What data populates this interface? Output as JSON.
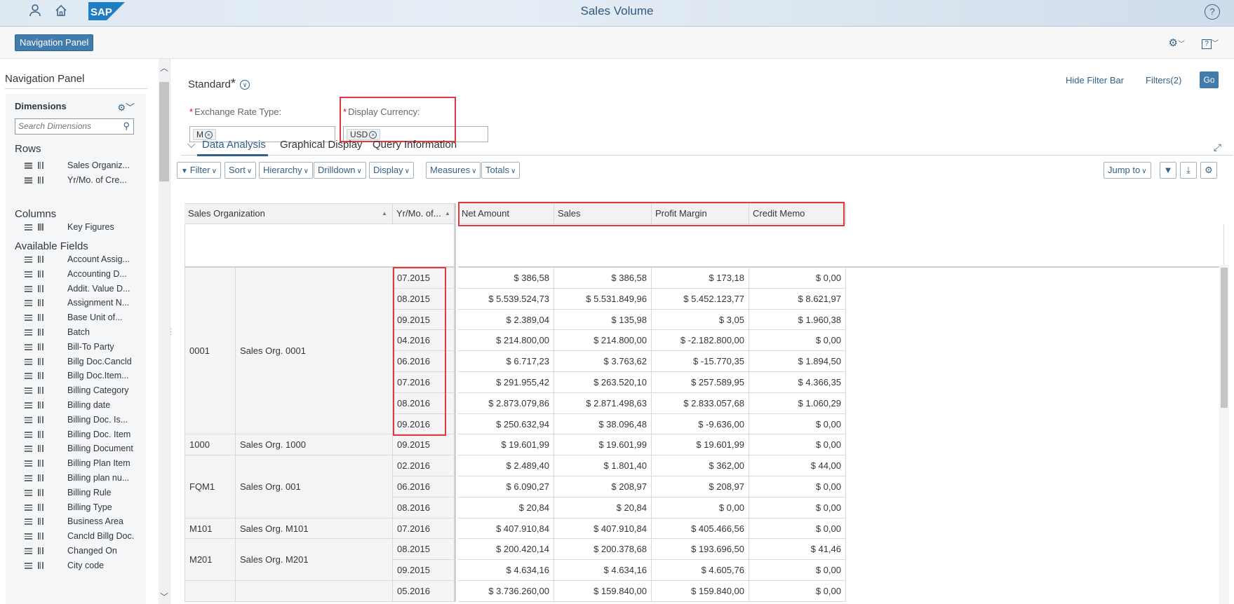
{
  "shell": {
    "title": "Sales Volume",
    "logo_text": "SAP",
    "icons": [
      "user-icon",
      "home-icon",
      "help-icon"
    ]
  },
  "subheader": {
    "nav_button": "Navigation Panel"
  },
  "nav_panel": {
    "title": "Navigation Panel",
    "dimensions_title": "Dimensions",
    "search_placeholder": "Search Dimensions",
    "rows_label": "Rows",
    "rows": [
      "Sales Organiz...",
      "Yr/Mo. of Cre..."
    ],
    "columns_label": "Columns",
    "columns": [
      "Key Figures"
    ],
    "available_label": "Available Fields",
    "available": [
      "Account Assig...",
      "Accounting D...",
      "Addit. Value D...",
      "Assignment N...",
      "Base Unit of...",
      "Batch",
      "Bill-To Party",
      "Billg Doc.Cancld",
      "Billg Doc.Item...",
      "Billing Category",
      "Billing date",
      "Billing Doc. Is...",
      "Billing Doc. Item",
      "Billing Document",
      "Billing Plan Item",
      "Billing plan nu...",
      "Billing Rule",
      "Billing Type",
      "Business Area",
      "Cancld Billg Doc.",
      "Changed On",
      "City code"
    ]
  },
  "filterbar": {
    "variant": "Standard",
    "variant_mark": "*",
    "hide_filter_bar": "Hide Filter Bar",
    "filters": "Filters(2)",
    "go": "Go",
    "required_mark": "*",
    "exchange_rate_label": "Exchange Rate Type:",
    "exchange_rate_token": "M",
    "display_currency_label": "Display Currency:",
    "display_currency_token": "USD"
  },
  "tabs": [
    "Data Analysis",
    "Graphical Display",
    "Query Information"
  ],
  "toolbar": {
    "buttons": [
      "Filter",
      "Sort",
      "Hierarchy",
      "Drilldown",
      "Display",
      "Measures",
      "Totals"
    ],
    "jump_to": "Jump to"
  },
  "table": {
    "row_headers": [
      "Sales Organization",
      "Yr/Mo. of..."
    ],
    "columns": [
      "Net Amount",
      "Sales",
      "Profit Margin",
      "Credit Memo"
    ],
    "groups": [
      {
        "code": "0001",
        "name": "Sales Org. 0001",
        "rows": [
          {
            "period": "07.2015",
            "values": [
              "$ 386,58",
              "$ 386,58",
              "$ 173,18",
              "$ 0,00"
            ]
          },
          {
            "period": "08.2015",
            "values": [
              "$ 5.539.524,73",
              "$ 5.531.849,96",
              "$ 5.452.123,77",
              "$ 8.621,97"
            ]
          },
          {
            "period": "09.2015",
            "values": [
              "$ 2.389,04",
              "$ 135,98",
              "$ 3,05",
              "$ 1.960,38"
            ]
          },
          {
            "period": "04.2016",
            "values": [
              "$ 214.800,00",
              "$ 214.800,00",
              "$ -2.182.800,00",
              "$ 0,00"
            ]
          },
          {
            "period": "06.2016",
            "values": [
              "$ 6.717,23",
              "$ 3.763,62",
              "$ -15.770,35",
              "$ 1.894,50"
            ]
          },
          {
            "period": "07.2016",
            "values": [
              "$ 291.955,42",
              "$ 263.520,10",
              "$ 257.589,95",
              "$ 4.366,35"
            ]
          },
          {
            "period": "08.2016",
            "values": [
              "$ 2.873.079,86",
              "$ 2.871.498,63",
              "$ 2.833.057,68",
              "$ 1.060,29"
            ]
          },
          {
            "period": "09.2016",
            "values": [
              "$ 250.632,94",
              "$ 38.096,48",
              "$ -9.636,00",
              "$ 0,00"
            ]
          }
        ]
      },
      {
        "code": "1000",
        "name": "Sales Org. 1000",
        "rows": [
          {
            "period": "09.2015",
            "values": [
              "$ 19.601,99",
              "$ 19.601,99",
              "$ 19.601,99",
              "$ 0,00"
            ]
          }
        ]
      },
      {
        "code": "FQM1",
        "name": "Sales Org. 001",
        "rows": [
          {
            "period": "02.2016",
            "values": [
              "$ 2.489,40",
              "$ 1.801,40",
              "$ 362,00",
              "$ 44,00"
            ]
          },
          {
            "period": "06.2016",
            "values": [
              "$ 6.090,27",
              "$ 208,97",
              "$ 208,97",
              "$ 0,00"
            ]
          },
          {
            "period": "08.2016",
            "values": [
              "$ 20,84",
              "$ 20,84",
              "$ 0,00",
              "$ 0,00"
            ]
          }
        ]
      },
      {
        "code": "M101",
        "name": "Sales Org. M101",
        "rows": [
          {
            "period": "07.2016",
            "values": [
              "$ 407.910,84",
              "$ 407.910,84",
              "$ 405.466,56",
              "$ 0,00"
            ]
          }
        ]
      },
      {
        "code": "M201",
        "name": "Sales Org. M201",
        "rows": [
          {
            "period": "08.2015",
            "values": [
              "$ 200.420,14",
              "$ 200.378,68",
              "$ 193.696,50",
              "$ 41,46"
            ]
          },
          {
            "period": "09.2015",
            "values": [
              "$ 4.634,16",
              "$ 4.634,16",
              "$ 4.605,76",
              "$ 0,00"
            ]
          }
        ]
      },
      {
        "code": "",
        "name": "",
        "rows": [
          {
            "period": "05.2016",
            "values": [
              "$ 3.736.260,00",
              "$ 159.840,00",
              "$ 159.840,00",
              "$ 0,00"
            ]
          }
        ]
      }
    ]
  }
}
